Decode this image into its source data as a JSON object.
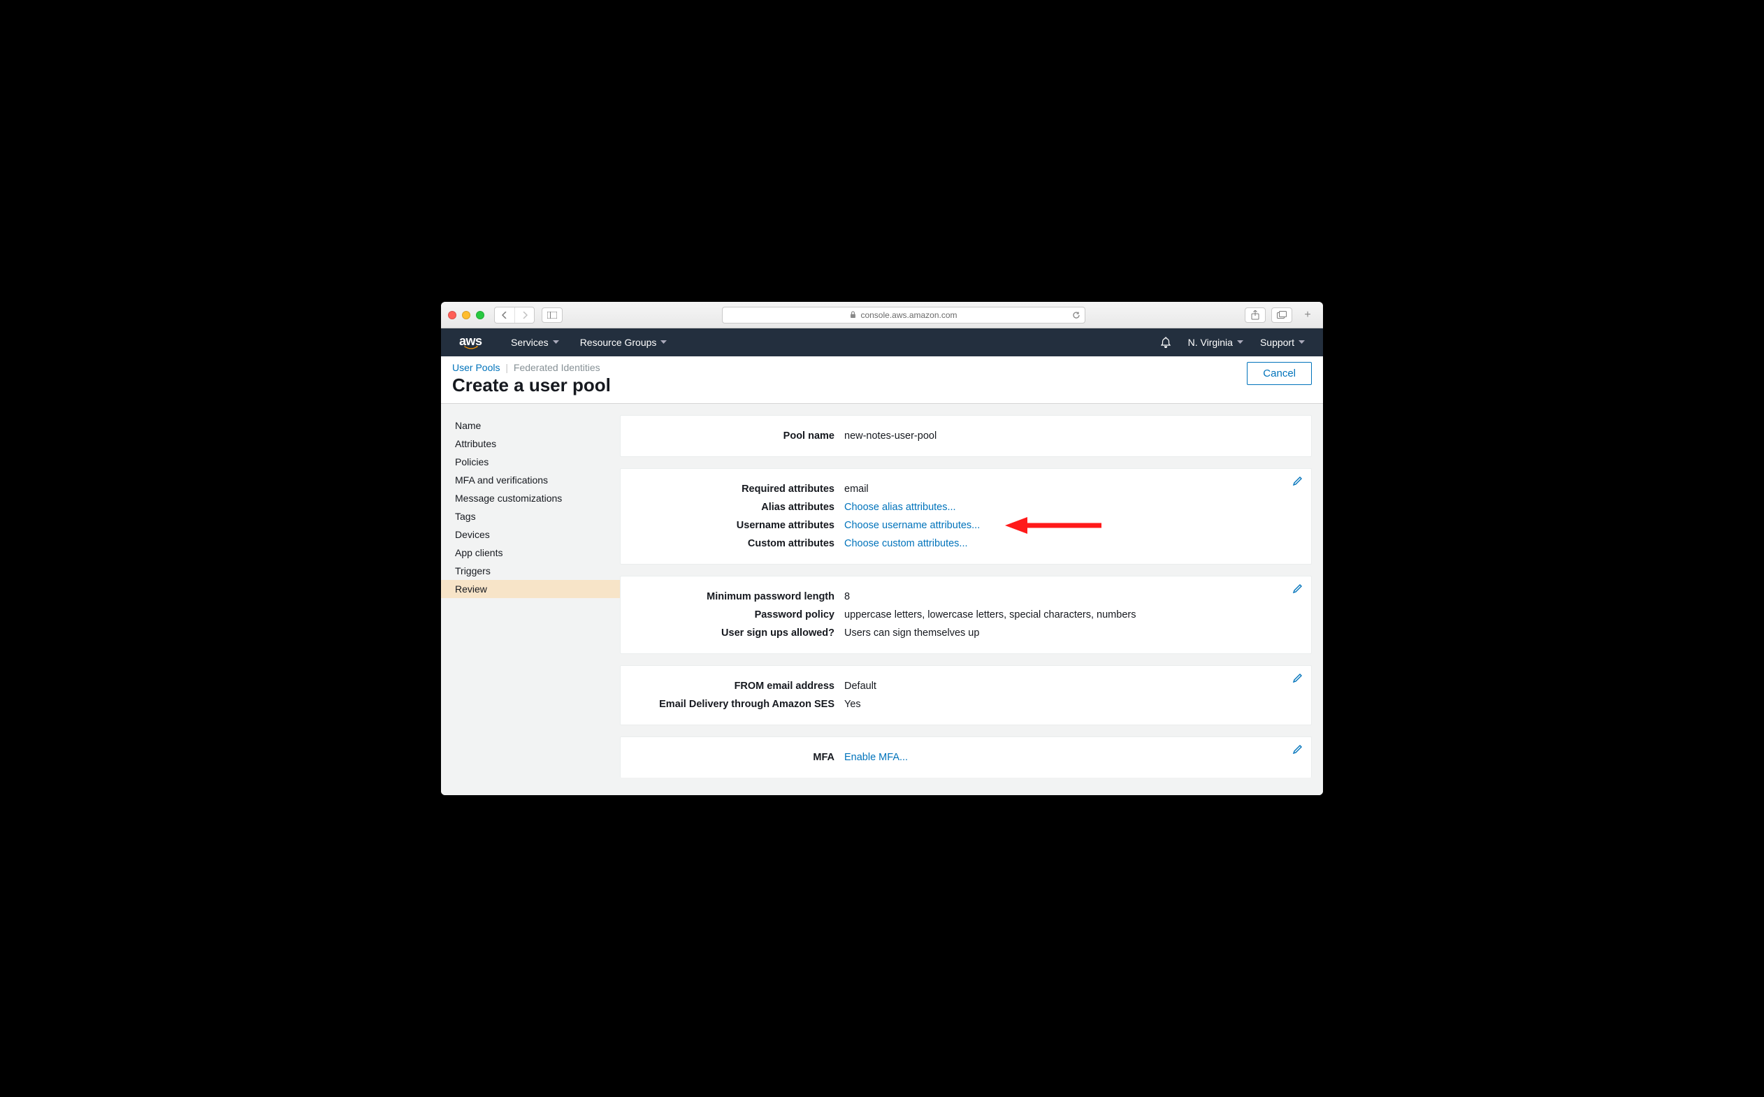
{
  "browser": {
    "url": "console.aws.amazon.com"
  },
  "header": {
    "logo": "aws",
    "nav": {
      "services": "Services",
      "resource_groups": "Resource Groups"
    },
    "right": {
      "region": "N. Virginia",
      "support": "Support"
    }
  },
  "subheader": {
    "breadcrumb": {
      "user_pools": "User Pools",
      "federated": "Federated Identities"
    },
    "title": "Create a user pool",
    "cancel": "Cancel"
  },
  "sidebar": {
    "items": [
      {
        "label": "Name"
      },
      {
        "label": "Attributes"
      },
      {
        "label": "Policies"
      },
      {
        "label": "MFA and verifications"
      },
      {
        "label": "Message customizations"
      },
      {
        "label": "Tags"
      },
      {
        "label": "Devices"
      },
      {
        "label": "App clients"
      },
      {
        "label": "Triggers"
      },
      {
        "label": "Review",
        "active": true
      }
    ]
  },
  "cards": {
    "name": {
      "pool_name_label": "Pool name",
      "pool_name_value": "new-notes-user-pool"
    },
    "attributes": {
      "required_label": "Required attributes",
      "required_value": "email",
      "alias_label": "Alias attributes",
      "alias_link": "Choose alias attributes...",
      "username_label": "Username attributes",
      "username_link": "Choose username attributes...",
      "custom_label": "Custom attributes",
      "custom_link": "Choose custom attributes..."
    },
    "policies": {
      "min_len_label": "Minimum password length",
      "min_len_value": "8",
      "policy_label": "Password policy",
      "policy_value": "uppercase letters, lowercase letters, special characters, numbers",
      "signups_label": "User sign ups allowed?",
      "signups_value": "Users can sign themselves up"
    },
    "email": {
      "from_label": "FROM email address",
      "from_value": "Default",
      "ses_label": "Email Delivery through Amazon SES",
      "ses_value": "Yes"
    },
    "mfa": {
      "mfa_label": "MFA",
      "mfa_link": "Enable MFA..."
    }
  },
  "annotation": {
    "target": "username-attributes-link"
  }
}
